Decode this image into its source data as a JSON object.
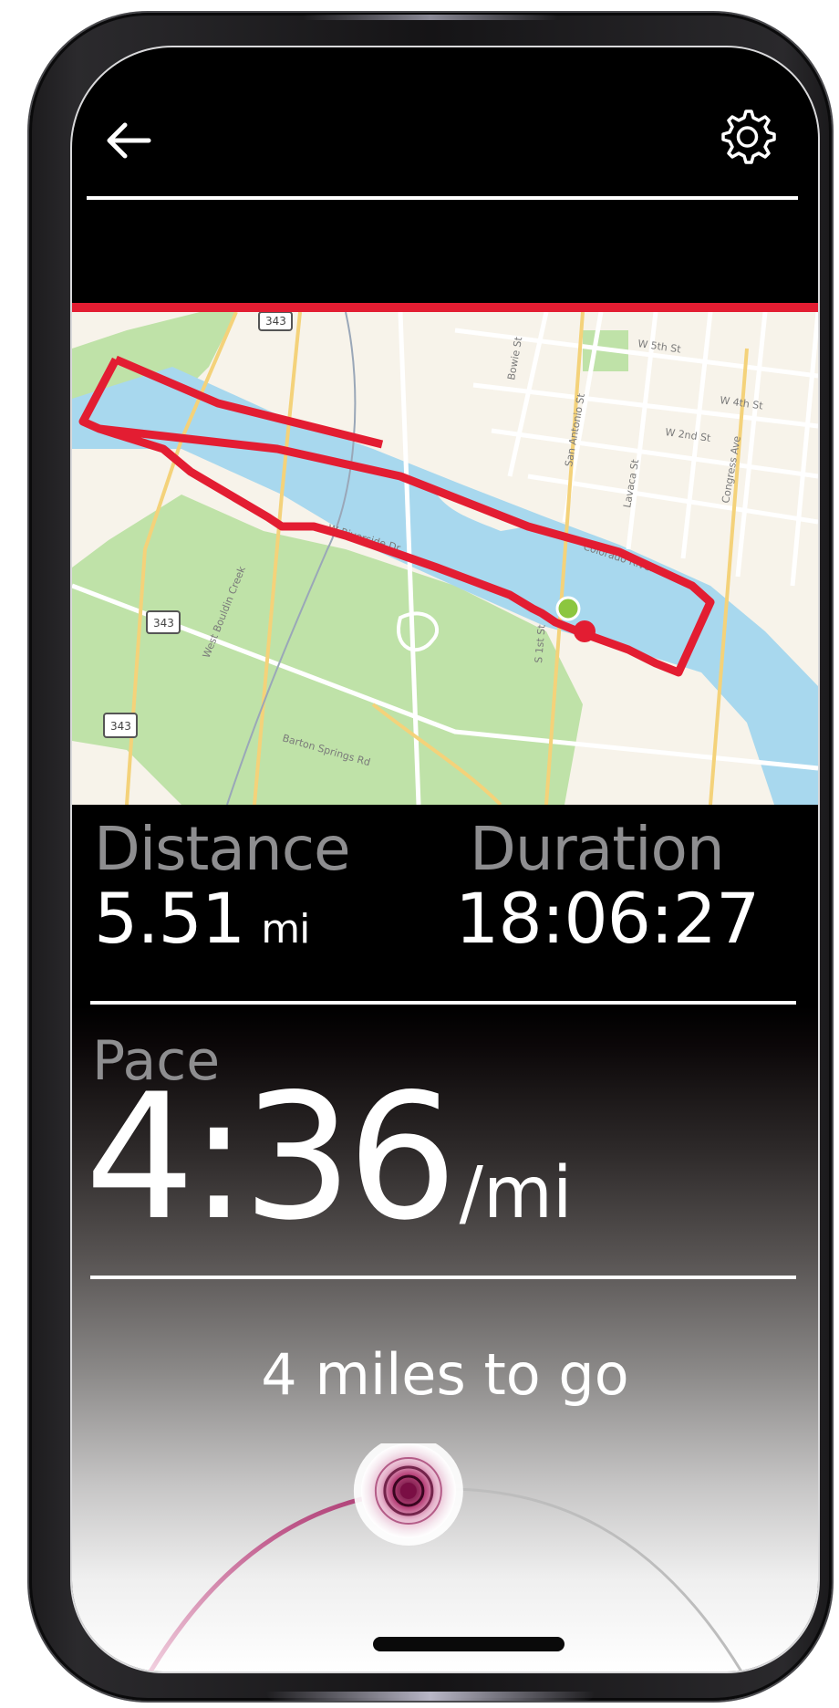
{
  "nav": {
    "back_icon": "arrow-left-icon",
    "settings_icon": "gear-icon"
  },
  "map": {
    "route_color": "#e31d32",
    "water_color": "#a8d8ee",
    "park_color": "#bfe2a8",
    "road_labels": [
      "W 5th St",
      "W 4th St",
      "W 2nd St",
      "Colorado River",
      "W Riverside Dr",
      "West Bouldin Creek",
      "Barton Springs Rd",
      "Lavaca St",
      "Congress Ave",
      "San Antonio St",
      "Bowie St",
      "S 1st St"
    ],
    "highway_shields": [
      "343",
      "343",
      "343"
    ]
  },
  "stats": {
    "distance_label": "Distance",
    "distance_value": "5.51",
    "distance_unit": "mi",
    "duration_label": "Duration",
    "duration_value": "18:06:27"
  },
  "pace": {
    "label": "Pace",
    "value": "4:36",
    "unit": "/mi"
  },
  "goal": {
    "text": "4 miles to go",
    "progress": 0.45,
    "accent": "#a3185f"
  }
}
